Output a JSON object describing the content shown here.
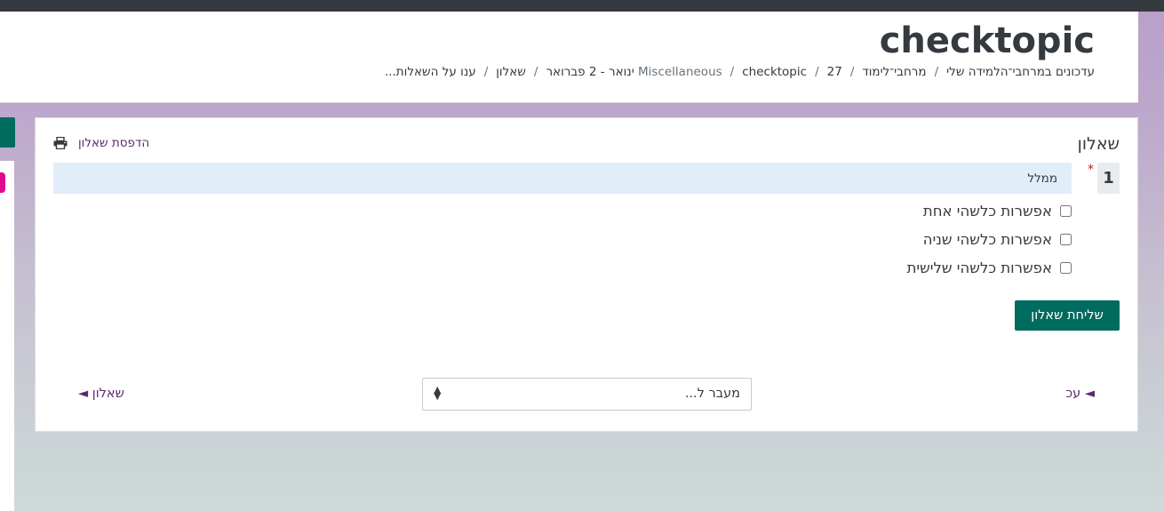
{
  "header": {
    "title": "checktopic",
    "breadcrumb": [
      "עדכונים במרחבי־הלמידה שלי",
      "מרחבי־לימוד",
      "Miscellaneous",
      "checktopic",
      "27 ינואר - 2 פברואר",
      "שאלון",
      "ענו על השאלות..."
    ],
    "breadcrumb_separator": "/"
  },
  "survey": {
    "heading": "שאלון",
    "print_label": "הדפסת שאלון",
    "question": {
      "number": "1",
      "required_mark": "*",
      "text": "ממלל",
      "options": [
        "אפשרות כלשהי אחת",
        "אפשרות כלשהי שניה",
        "אפשרות כלשהי שלישית"
      ]
    },
    "submit_label": "שליחת שאלון"
  },
  "navigation": {
    "prev_label": "◄ עכ",
    "jump_placeholder": "מעבר ל...",
    "next_label": "שאלון ◄"
  },
  "colors": {
    "topbar": "#343a40",
    "primary": "#006b5f",
    "link": "#5b2a6e",
    "question_bg": "#e1eef9",
    "required": "#d0121c",
    "accent_pink": "#e20a8f"
  }
}
